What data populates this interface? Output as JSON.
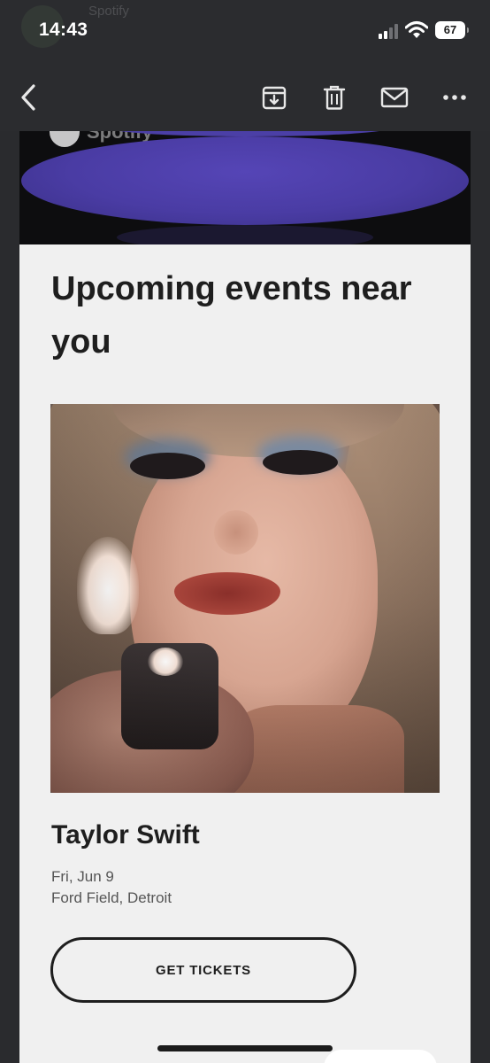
{
  "status_bar": {
    "time": "14:43",
    "battery": "67",
    "background_sender": "Spotify"
  },
  "toolbar": {
    "icons": [
      "chevron-left-icon",
      "archive-icon",
      "trash-icon",
      "mail-icon",
      "more-icon"
    ]
  },
  "email": {
    "banner_logo_text": "Spotify",
    "heading": "Upcoming events near you",
    "event": {
      "artist": "Taylor Swift",
      "date": "Fri, Jun 9",
      "venue": "Ford Field, Detroit",
      "button_label": "GET TICKETS"
    }
  },
  "colors": {
    "banner_purple": "#4a3ca4",
    "banner_dark": "#0d0d0f",
    "email_bg": "#f0f0f0",
    "chrome_bg": "#2b2c2f"
  }
}
